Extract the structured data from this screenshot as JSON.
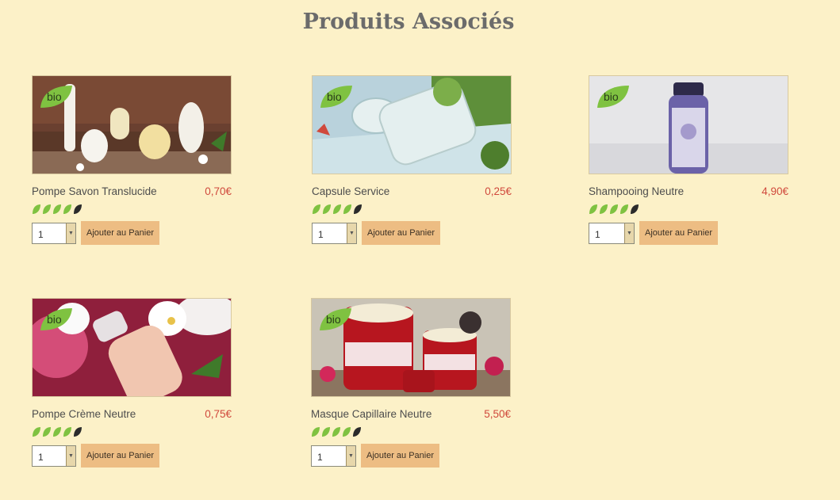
{
  "section_title": "Produits Associés",
  "badge_label": "bio",
  "add_button_label": "Ajouter au Panier",
  "colors": {
    "background": "#fcf1c8",
    "price": "#d0493c",
    "button": "#edbd83",
    "leaf_active": "#7fc241",
    "leaf_inactive": "#2b2b2b"
  },
  "products": [
    {
      "name": "Pompe Savon Translucide",
      "price": "0,70€",
      "rating": 4,
      "quantity": "1",
      "image": "soap-pump-bottles"
    },
    {
      "name": "Capsule Service",
      "price": "0,25€",
      "rating": 4,
      "quantity": "1",
      "image": "clear-service-cap"
    },
    {
      "name": "Shampooing Neutre",
      "price": "4,90€",
      "rating": 4,
      "quantity": "1",
      "image": "shampoo-bottle"
    },
    {
      "name": "Pompe Crème Neutre",
      "price": "0,75€",
      "rating": 4,
      "quantity": "1",
      "image": "cream-pump-bottle"
    },
    {
      "name": "Masque Capillaire Neutre",
      "price": "5,50€",
      "rating": 4,
      "quantity": "1",
      "image": "hair-mask-jars"
    }
  ]
}
